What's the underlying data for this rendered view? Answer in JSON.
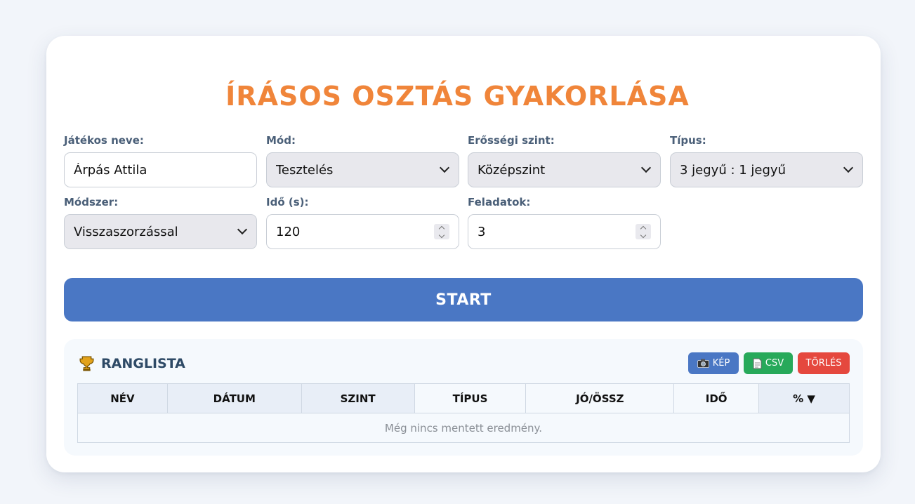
{
  "title": "ÍRÁSOS OSZTÁS GYAKORLÁSA",
  "fields": {
    "player": {
      "label": "Játékos neve:",
      "value": "Árpás Attila"
    },
    "mode": {
      "label": "Mód:",
      "value": "Tesztelés"
    },
    "level": {
      "label": "Erősségi szint:",
      "value": "Középszint"
    },
    "type": {
      "label": "Típus:",
      "value": "3 jegyű : 1 jegyű"
    },
    "method": {
      "label": "Módszer:",
      "value": "Visszaszorzással"
    },
    "time": {
      "label": "Idő (s):",
      "value": "120"
    },
    "tasks": {
      "label": "Feladatok:",
      "value": "3"
    }
  },
  "start_label": "START",
  "leaderboard": {
    "title": "RANGLISTA",
    "buttons": {
      "image": "KÉP",
      "csv": "CSV",
      "delete": "TÖRLÉS"
    },
    "columns": [
      "NÉV",
      "DÁTUM",
      "SZINT",
      "TÍPUS",
      "JÓ/ÖSSZ",
      "IDŐ",
      "% ▼"
    ],
    "empty_text": "Még nincs mentett eredmény."
  },
  "colors": {
    "title": "#f0853a",
    "primary": "#4a77c4",
    "csv": "#27a95a",
    "delete": "#e5483e"
  },
  "icons": {
    "trophy": "trophy-icon",
    "camera": "camera-icon",
    "document": "document-icon"
  }
}
